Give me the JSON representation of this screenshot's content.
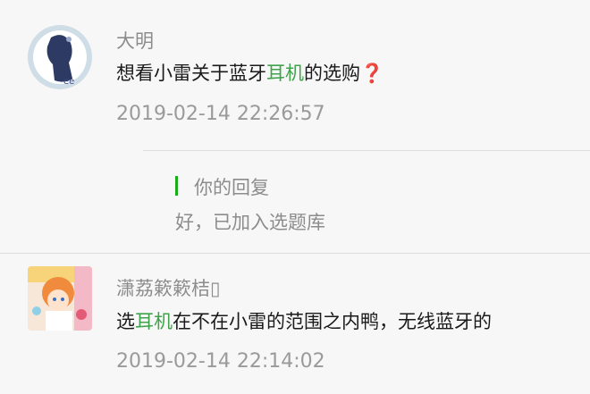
{
  "comments": [
    {
      "nickname": "大明",
      "content_before": "想看小雷关于蓝牙",
      "content_highlight": "耳机",
      "content_after": "的选购",
      "content_icon": "❓",
      "timestamp": "2019-02-14 22:26:57",
      "avatar_icon": "silhouette-avatar-icon",
      "reply": {
        "title": "你的回复",
        "text": "好，已加入选题库"
      }
    },
    {
      "nickname": "潇荔簌簌桔▯",
      "content_before": "选",
      "content_highlight": "耳机",
      "content_after": "在不在小雷的范围之内鸭，无线蓝牙的",
      "timestamp": "2019-02-14 22:14:02",
      "avatar_icon": "anime-character-avatar-icon"
    }
  ],
  "colors": {
    "highlight": "#3ea34a",
    "reply_accent": "#1aad19",
    "background": "#f7f7f7"
  }
}
